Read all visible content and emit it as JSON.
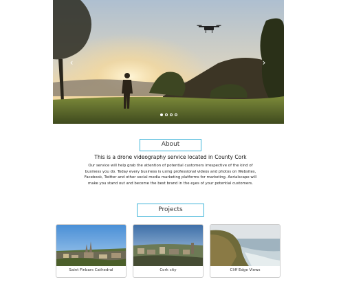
{
  "carousel": {
    "prev_label": "‹",
    "next_label": "›",
    "slide_count": 4,
    "active_slide": 0
  },
  "about": {
    "title": "About",
    "lead": "This is a drone videography service located in County Cork",
    "body": "Our service will help grab the attention of potential customers irrespective of the kind of business you do. Today every business is using professional videos and photos on Websites, Facebook, Twitter and other social media marketing platforms for marketing. Aerialscape will make you stand out and become the best brand in the eyes of your potential customers."
  },
  "projects": {
    "title": "Projects",
    "items": [
      {
        "label": "Saint Finbars Cathedral"
      },
      {
        "label": "Cork city"
      },
      {
        "label": "Cliff Edge Views"
      }
    ]
  },
  "colors": {
    "accent_border": "#3ab2d8"
  }
}
